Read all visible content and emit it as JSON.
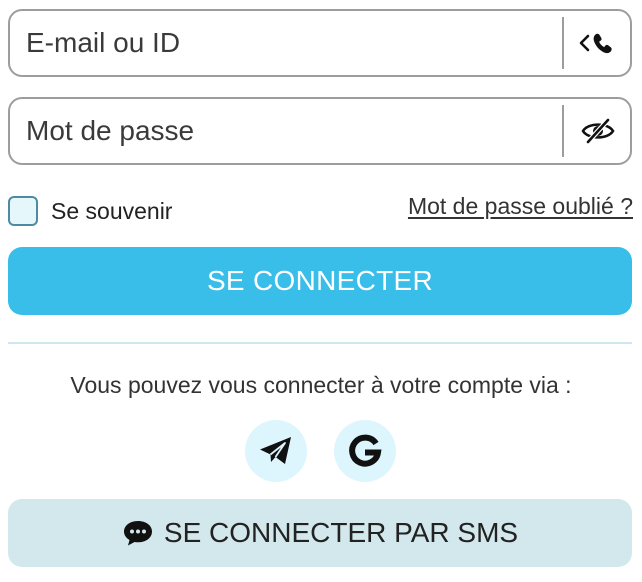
{
  "login_form": {
    "email_field": {
      "placeholder": "E-mail ou ID",
      "value": "",
      "suffix_icon": "phone-switch-icon"
    },
    "password_field": {
      "placeholder": "Mot de passe",
      "value": "",
      "suffix_icon": "eye-slash-icon"
    },
    "remember": {
      "label": "Se souvenir",
      "checked": false
    },
    "forgot_password_label": "Mot de passe oublié ?",
    "submit_label": "SE CONNECTER"
  },
  "social_login": {
    "prompt": "Vous pouvez vous connecter à votre compte via :",
    "providers": [
      {
        "icon": "telegram-icon"
      },
      {
        "icon": "google-icon"
      }
    ]
  },
  "sms_login": {
    "label": "SE CONNECTER PAR SMS",
    "icon": "chat-bubble-icon"
  },
  "colors": {
    "primary": "#39bde9",
    "sms_button_bg": "#d3e8ec",
    "social_bg": "#ddf5fc",
    "border": "#9d9d9d"
  }
}
